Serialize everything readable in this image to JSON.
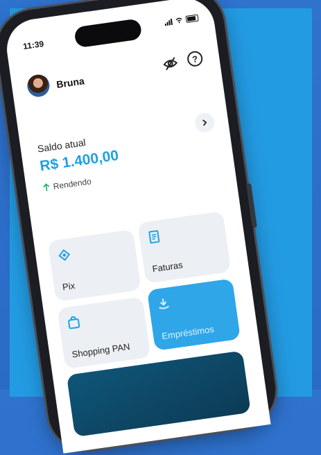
{
  "status_bar": {
    "time": "11:39"
  },
  "header": {
    "user_name": "Bruna"
  },
  "balance": {
    "label": "Saldo atual",
    "value": "R$ 1.400,00",
    "status": "Rendendo"
  },
  "shortcuts": [
    {
      "label": "Pix",
      "icon": "pix-icon"
    },
    {
      "label": "Faturas",
      "icon": "invoice-icon"
    },
    {
      "label": "Shopping PAN",
      "icon": "shopping-bag-icon"
    },
    {
      "label": "Empréstimos",
      "icon": "loan-icon"
    }
  ],
  "colors": {
    "accent": "#1da1e6",
    "background": "#239be3",
    "tile": "#eceff3",
    "highlight_tile": "#2fa6e8"
  }
}
